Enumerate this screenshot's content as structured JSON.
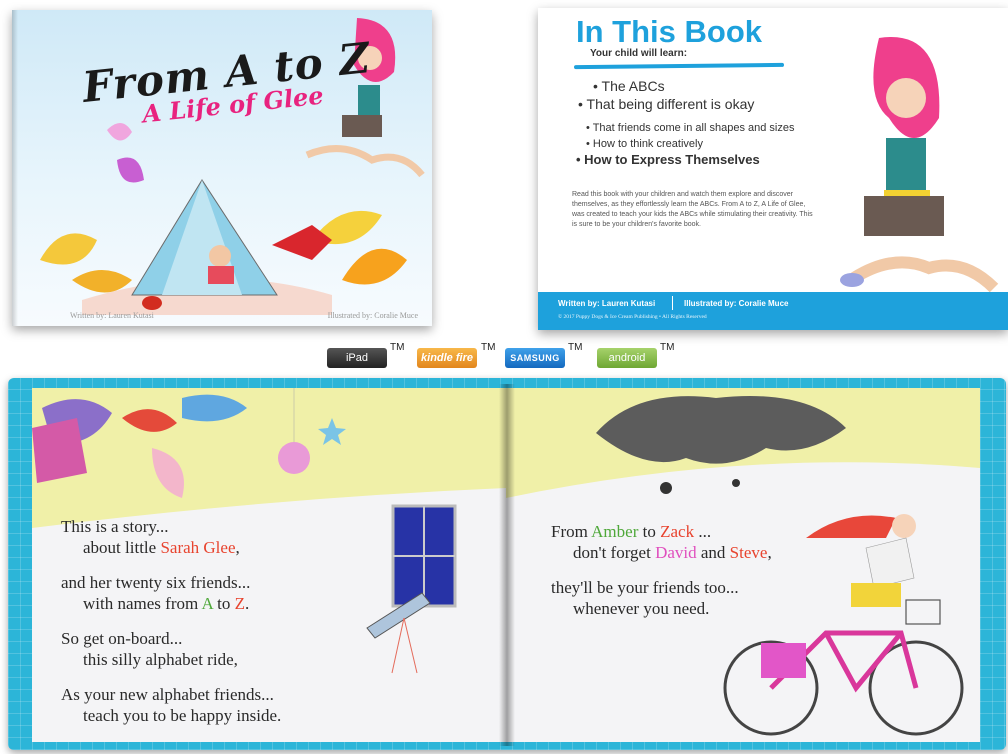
{
  "cover": {
    "title": "From A to Z",
    "subtitle": "A Life of Glee",
    "author": "Written by: Lauren Kutasi",
    "illustrator": "Illustrated by: Coralie Muce"
  },
  "back_cover": {
    "heading": "In This Book",
    "intro": "Your child will learn:",
    "learnings": [
      "• The ABCs",
      "• That being different is okay",
      "• That friends come in all shapes and sizes",
      "• How to think creatively",
      "• How to Express Themselves"
    ],
    "description": "Read this book with your children and watch them explore and discover themselves, as they effortlessly learn the ABCs. From A to Z, A Life of Glee, was created to teach your kids the ABCs while stimulating their creativity. This is sure to be your children's favorite book.",
    "footer": {
      "writer": "Written by: Lauren Kutasi",
      "artist": "Illustrated by: Coralie Muce",
      "copyright": "© 2017 Puppy Dogs & Ice Cream Publishing • All Rights Reserved"
    }
  },
  "badges": [
    {
      "label": "iPad",
      "tm": "TM"
    },
    {
      "label": "kindle fire",
      "tm": "TM"
    },
    {
      "label": "SAMSUNG",
      "tm": "TM"
    },
    {
      "label": "android",
      "tm": "TM"
    }
  ],
  "left_page": {
    "verse1": {
      "line1": "This is a story...",
      "line2_pre": "about little ",
      "line2_name": "Sarah Glee",
      "line2_post": ","
    },
    "verse2": {
      "line1": "and her twenty six friends...",
      "line2_pre": "with names from ",
      "a": "A",
      "mid": " to ",
      "z": "Z",
      "post": "."
    },
    "verse3": {
      "line1": "So get on-board...",
      "line2": "this silly alphabet ride,"
    },
    "verse4": {
      "line1": "As your new alphabet friends...",
      "line2": "teach you to be happy inside."
    }
  },
  "right_page": {
    "verse1": {
      "pre": "From ",
      "amber": "Amber",
      "to": " to ",
      "zack": "Zack",
      "ellipsis": " ...",
      "line2_pre": "don't forget ",
      "david": "David",
      "and": " and ",
      "steve": "Steve",
      "comma": ","
    },
    "verse2": {
      "line1": "they'll be your friends too...",
      "line2": "whenever you need."
    }
  },
  "colors": {
    "brand_blue": "#1ea1dc",
    "title_pink": "#e8237f",
    "name_red": "#e8432e",
    "name_green": "#4fa83a",
    "name_pink": "#e04fbe"
  }
}
